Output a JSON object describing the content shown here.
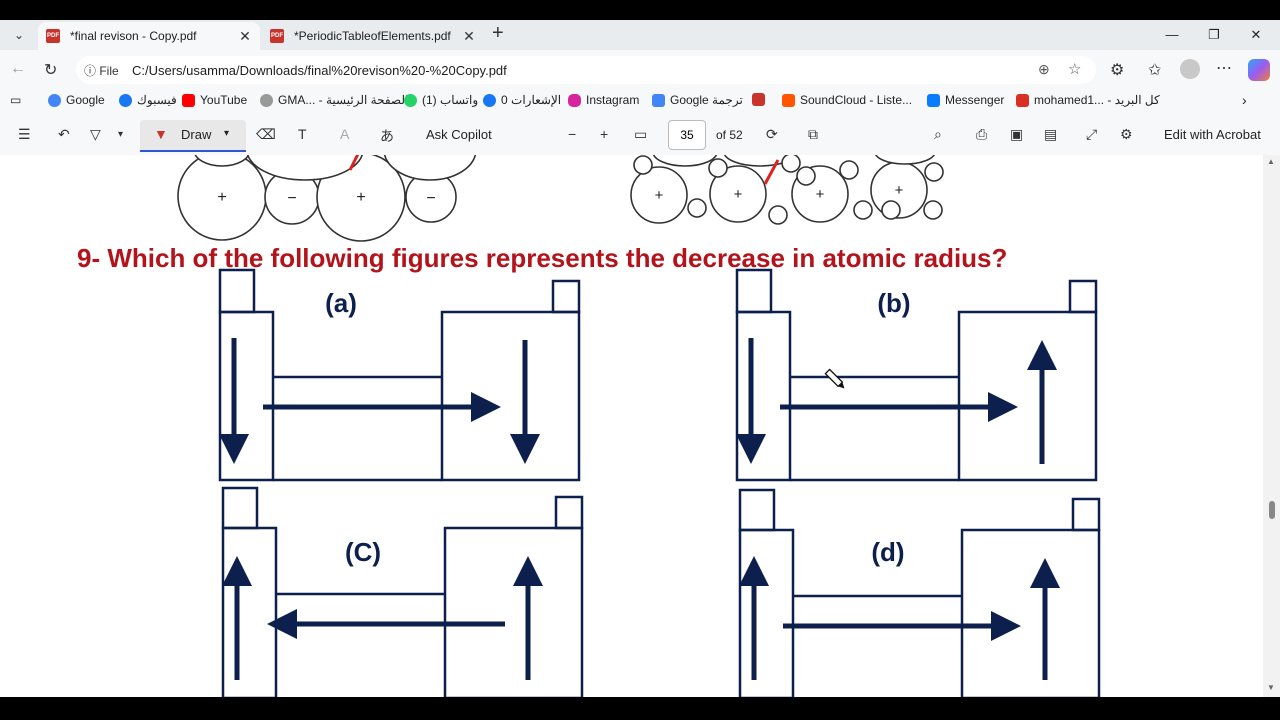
{
  "tabs": [
    {
      "title": "*final revison - Copy.pdf",
      "icon": "pdf-icon"
    },
    {
      "title": "*PeriodicTableofElements.pdf",
      "icon": "pdf-icon"
    }
  ],
  "address": {
    "scheme_label": "File",
    "url": "C:/Users/usamma/Downloads/final%20revison%20-%20Copy.pdf"
  },
  "favorites": [
    {
      "label": "Google"
    },
    {
      "label": "فيسبوك"
    },
    {
      "label": "YouTube"
    },
    {
      "label": "GMA... - الصفحة الرئيسية"
    },
    {
      "label": "(1) واتساب"
    },
    {
      "label": "0 الإشعارات"
    },
    {
      "label": "Instagram"
    },
    {
      "label": "Google ترجمة"
    },
    {
      "label": "SoundCloud - Liste..."
    },
    {
      "label": "Messenger"
    },
    {
      "label": "mohamed1... - كل البريد"
    }
  ],
  "pdf_toolbar": {
    "draw_label": "Draw",
    "ask_copilot": "Ask Copilot",
    "page_current": "35",
    "page_total": "of 52",
    "edit_acrobat": "Edit with Acrobat"
  },
  "document": {
    "question": "9- Which of the following figures represents the decrease in atomic radius?",
    "options": [
      {
        "label": "(a)"
      },
      {
        "label": "(b)"
      },
      {
        "label": "(C)"
      },
      {
        "label": "(d)"
      }
    ],
    "ion_signs": {
      "plus": "+",
      "minus": "−"
    }
  },
  "colors": {
    "question_red": "#b3131b",
    "figure_navy": "#0d1f4d",
    "tab_bg": "#e9ecef",
    "toolbar_bg": "#f7f8f9"
  }
}
